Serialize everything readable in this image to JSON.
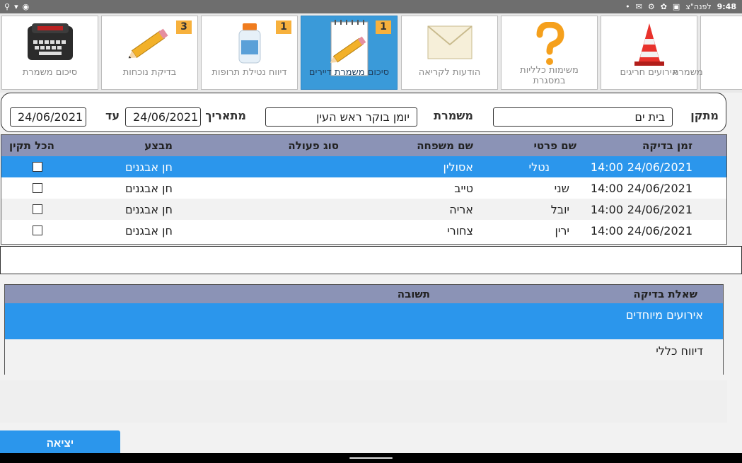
{
  "status_bar": {
    "time": "9:48",
    "date_label": "לפנה\"צ"
  },
  "tiles": [
    {
      "label": "סיכום משמרת",
      "icon": "typewriter-icon",
      "badge": ""
    },
    {
      "label": "בדיקת נוכחות",
      "icon": "pencil-icon",
      "badge": "3"
    },
    {
      "label": "דיווח נטילת תרופות",
      "icon": "pill-bottle-icon",
      "badge": "1"
    },
    {
      "label": "סיכום משמרת דיירים",
      "icon": "notepad-pencil-icon",
      "badge": "1"
    },
    {
      "label": "הודעות לקריאה",
      "icon": "envelope-icon",
      "badge": ""
    },
    {
      "label_line1": "משימות כלליות",
      "label_line2": "במסגרת",
      "icon": "question-mark-icon",
      "badge": ""
    },
    {
      "label": "אירועים חריגים",
      "icon": "traffic-cone-icon",
      "badge": ""
    },
    {
      "label": "משמרת",
      "icon": "partial-icon",
      "badge": ""
    }
  ],
  "filter": {
    "facility_label": "מתקן",
    "facility_value": "בית ים",
    "shift_label": "משמרת",
    "shift_value": "יומן בוקר ראש העין",
    "from_label": "מתאריך",
    "from_value": "24/06/2021",
    "to_label": "עד",
    "to_value": "24/06/2021"
  },
  "grid": {
    "headers": {
      "check_time": "זמן בדיקה",
      "first_name": "שם פרטי",
      "last_name": "שם משפחה",
      "action_type": "סוג פעולה",
      "performer": "מבצע",
      "all_ok": "הכל תקין"
    },
    "rows": [
      {
        "date": "24/06/2021",
        "time": "14:00",
        "first_name": "נטלי",
        "last_name": "אסולין",
        "action_type": "",
        "performer": "חן אבגנים"
      },
      {
        "date": "24/06/2021",
        "time": "14:00",
        "first_name": "שני",
        "last_name": "טייב",
        "action_type": "",
        "performer": "חן אבגנים"
      },
      {
        "date": "24/06/2021",
        "time": "14:00",
        "first_name": "יובל",
        "last_name": "אריה",
        "action_type": "",
        "performer": "חן אבגנים"
      },
      {
        "date": "24/06/2021",
        "time": "14:00",
        "first_name": "ירין",
        "last_name": "צחורי",
        "action_type": "",
        "performer": "חן אבגנים"
      }
    ]
  },
  "questions": {
    "headers": {
      "question": "שאלת בדיקה",
      "answer": "תשובה"
    },
    "rows": [
      {
        "question": "אירועים מיוחדים"
      },
      {
        "question": "דיווח כללי"
      }
    ]
  },
  "exit_label": "יציאה",
  "colors": {
    "accent": "#2b96ec",
    "header": "#8b93b6",
    "badge": "#f7b13d",
    "active_tile": "#3a9ad9"
  }
}
